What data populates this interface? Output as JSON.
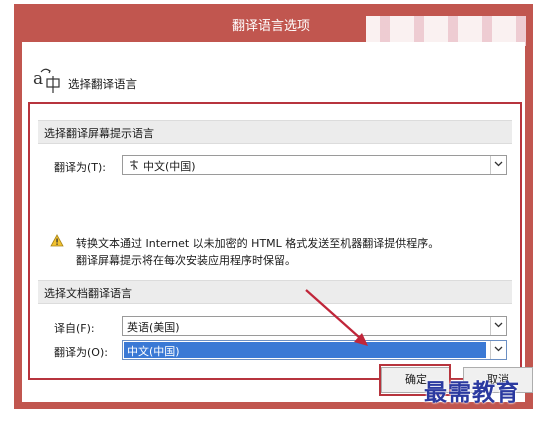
{
  "window": {
    "title": "翻译语言选项"
  },
  "header": {
    "label": "选择翻译语言",
    "icon": "translate-icon"
  },
  "screen_tip_section": {
    "heading": "选择翻译屏幕提示语言",
    "translate_to_label": "翻译为(T):",
    "translate_to_value": "中文(中国)",
    "warning_line1": "转换文本通过 Internet 以未加密的 HTML 格式发送至机器翻译提供程序。",
    "warning_line2": "翻译屏幕提示将在每次安装应用程序时保留。"
  },
  "document_section": {
    "heading": "选择文档翻译语言",
    "from_label": "译自(F):",
    "from_value": "英语(美国)",
    "to_label": "翻译为(O):",
    "to_value": "中文(中国)"
  },
  "buttons": {
    "ok": "确定",
    "cancel": "取消"
  },
  "watermark": "最需教育",
  "colors": {
    "title_bar": "#c1564f",
    "highlight_frame": "#b7343d",
    "selection": "#3a79d5"
  }
}
